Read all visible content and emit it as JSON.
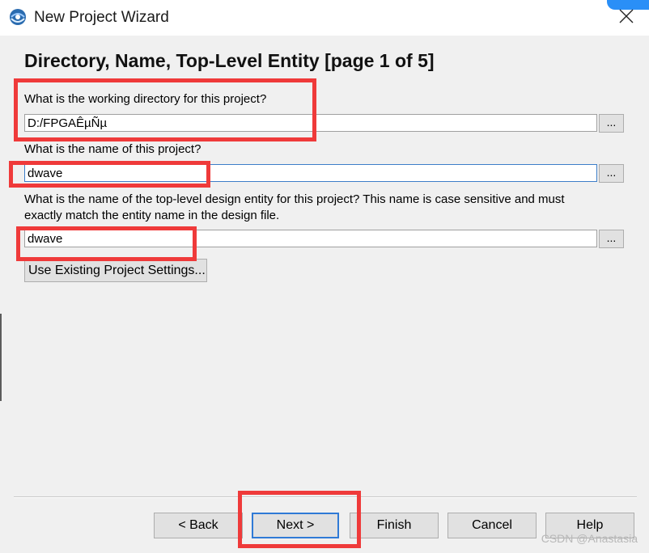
{
  "window": {
    "title": "New Project Wizard"
  },
  "page": {
    "heading": "Directory, Name, Top-Level Entity [page 1 of 5]"
  },
  "fields": {
    "directory": {
      "label": "What is the working directory for this project?",
      "value": "D:/FPGAÊµÑµ",
      "browse_label": "..."
    },
    "project_name": {
      "label": "What is the name of this project?",
      "value": "dwave",
      "browse_label": "..."
    },
    "top_entity": {
      "label_line1": "What is the name of the top-level design entity for this project? This name is case sensitive and must",
      "label_line2": "exactly match the entity name in the design file.",
      "value": "dwave",
      "browse_label": "..."
    }
  },
  "buttons": {
    "use_existing": "Use Existing Project Settings...",
    "back": "< Back",
    "next": "Next >",
    "finish": "Finish",
    "cancel": "Cancel",
    "help": "Help"
  },
  "watermark": "CSDN @Anastasia",
  "colors": {
    "annotation": "#ef3a3a",
    "focus": "#3d7ec8",
    "dialog_bg": "#f0f0f0"
  }
}
